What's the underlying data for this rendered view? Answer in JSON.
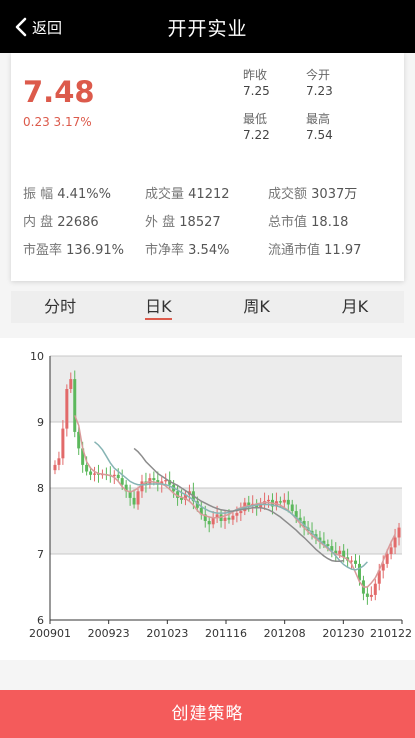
{
  "header": {
    "back_label": "返回",
    "title": "开开实业"
  },
  "quote": {
    "price": "7.48",
    "change": "0.23 3.17%",
    "prev_close_label": "昨收",
    "prev_close": "7.25",
    "open_label": "今开",
    "open": "7.23",
    "low_label": "最低",
    "low": "7.22",
    "high_label": "最高",
    "high": "7.54",
    "accent_color": "#dc5a4b"
  },
  "stats": [
    [
      {
        "label": "振 幅",
        "value": "4.41%%"
      },
      {
        "label": "成交量",
        "value": "41212"
      },
      {
        "label": "成交额",
        "value": "3037万"
      }
    ],
    [
      {
        "label": "内 盘",
        "value": "22686"
      },
      {
        "label": "外 盘",
        "value": "18527"
      },
      {
        "label": "总市值",
        "value": "18.18"
      }
    ],
    [
      {
        "label": "市盈率",
        "value": "136.91%"
      },
      {
        "label": "市净率",
        "value": "3.54%"
      },
      {
        "label": "流通市值",
        "value": "11.97"
      }
    ]
  ],
  "tabs": [
    "分时",
    "日K",
    "周K",
    "月K"
  ],
  "active_tab": 1,
  "chart_data": {
    "type": "candlestick",
    "ylim": [
      6,
      10
    ],
    "y_ticks": [
      "6",
      "7",
      "8",
      "9",
      "10"
    ],
    "x_tick_labels": [
      "200901",
      "200923",
      "201023",
      "201116",
      "201208",
      "201230",
      "210122"
    ],
    "up_color": "#e26a6a",
    "down_color": "#5cb85c",
    "ma_colors": [
      "#d99a9a",
      "#86b4b4",
      "#8c8c8c"
    ],
    "closes": [
      8.35,
      8.45,
      8.9,
      9.5,
      9.65,
      8.85,
      8.6,
      8.35,
      8.25,
      8.2,
      8.22,
      8.2,
      8.21,
      8.2,
      8.18,
      8.2,
      8.15,
      8.05,
      7.95,
      7.85,
      7.75,
      7.95,
      8.1,
      8.05,
      8.15,
      8.12,
      8.05,
      8.1,
      8.12,
      8.05,
      7.95,
      7.85,
      7.82,
      7.9,
      7.95,
      7.8,
      7.7,
      7.6,
      7.5,
      7.45,
      7.55,
      7.6,
      7.5,
      7.55,
      7.52,
      7.58,
      7.62,
      7.65,
      7.78,
      7.72,
      7.76,
      7.7,
      7.75,
      7.8,
      7.82,
      7.72,
      7.8,
      7.78,
      7.82,
      7.75,
      7.65,
      7.55,
      7.5,
      7.4,
      7.35,
      7.3,
      7.25,
      7.2,
      7.15,
      7.12,
      7.05,
      7.0,
      7.05,
      6.95,
      6.9,
      6.9,
      6.85,
      6.6,
      6.4,
      6.35,
      6.38,
      6.55,
      6.75,
      6.85,
      7.0,
      7.1,
      7.25,
      7.4
    ],
    "ma5": [
      null,
      null,
      null,
      null,
      null,
      9.1,
      8.95,
      8.6,
      8.4,
      8.3,
      8.25,
      8.22,
      8.21,
      8.2,
      8.19,
      8.16,
      8.1,
      8.02,
      7.96,
      7.94,
      7.96,
      8.0,
      8.05,
      8.08,
      8.1,
      8.09,
      8.08,
      8.06,
      8.03,
      7.98,
      7.92,
      7.88,
      7.86,
      7.84,
      7.8,
      7.74,
      7.66,
      7.6,
      7.58,
      7.56,
      7.55,
      7.55,
      7.56,
      7.58,
      7.6,
      7.64,
      7.68,
      7.7,
      7.72,
      7.73,
      7.74,
      7.76,
      7.77,
      7.78,
      7.78,
      7.77,
      7.76,
      7.74,
      7.7,
      7.66,
      7.6,
      7.53,
      7.46,
      7.4,
      7.34,
      7.28,
      7.23,
      7.18,
      7.13,
      7.08,
      7.03,
      7.0,
      6.98,
      6.95,
      6.92,
      6.85,
      6.72,
      6.58,
      6.5,
      6.5,
      6.56,
      6.64,
      6.76,
      6.9,
      7.05,
      7.18,
      7.3
    ],
    "ma10": [
      null,
      null,
      null,
      null,
      null,
      null,
      null,
      null,
      null,
      null,
      8.7,
      8.65,
      8.58,
      8.48,
      8.38,
      8.3,
      8.25,
      8.2,
      8.15,
      8.1,
      8.07,
      8.05,
      8.05,
      8.05,
      8.06,
      8.06,
      8.06,
      8.06,
      8.05,
      8.03,
      8.0,
      7.97,
      7.93,
      7.9,
      7.86,
      7.82,
      7.77,
      7.72,
      7.68,
      7.65,
      7.63,
      7.62,
      7.62,
      7.62,
      7.63,
      7.65,
      7.67,
      7.69,
      7.7,
      7.72,
      7.73,
      7.74,
      7.75,
      7.75,
      7.75,
      7.74,
      7.73,
      7.71,
      7.68,
      7.65,
      7.6,
      7.55,
      7.5,
      7.44,
      7.38,
      7.32,
      7.26,
      7.2,
      7.15,
      7.1,
      7.04,
      6.97,
      6.9,
      6.84,
      6.8,
      6.77,
      6.76,
      6.78,
      6.82,
      6.88
    ],
    "ma20": [
      null,
      null,
      null,
      null,
      null,
      null,
      null,
      null,
      null,
      null,
      null,
      null,
      null,
      null,
      null,
      null,
      null,
      null,
      null,
      null,
      8.6,
      8.55,
      8.48,
      8.4,
      8.34,
      8.28,
      8.22,
      8.18,
      8.14,
      8.1,
      8.07,
      8.04,
      8.0,
      7.96,
      7.92,
      7.88,
      7.84,
      7.8,
      7.77,
      7.74,
      7.71,
      7.69,
      7.67,
      7.66,
      7.65,
      7.65,
      7.66,
      7.67,
      7.68,
      7.69,
      7.7,
      7.7,
      7.7,
      7.69,
      7.67,
      7.64,
      7.6,
      7.56,
      7.51,
      7.46,
      7.41,
      7.36,
      7.3,
      7.25,
      7.19,
      7.13,
      7.07,
      7.02,
      6.97,
      6.93,
      6.9,
      6.89,
      6.89,
      6.9
    ]
  },
  "cta_label": "创建策略"
}
